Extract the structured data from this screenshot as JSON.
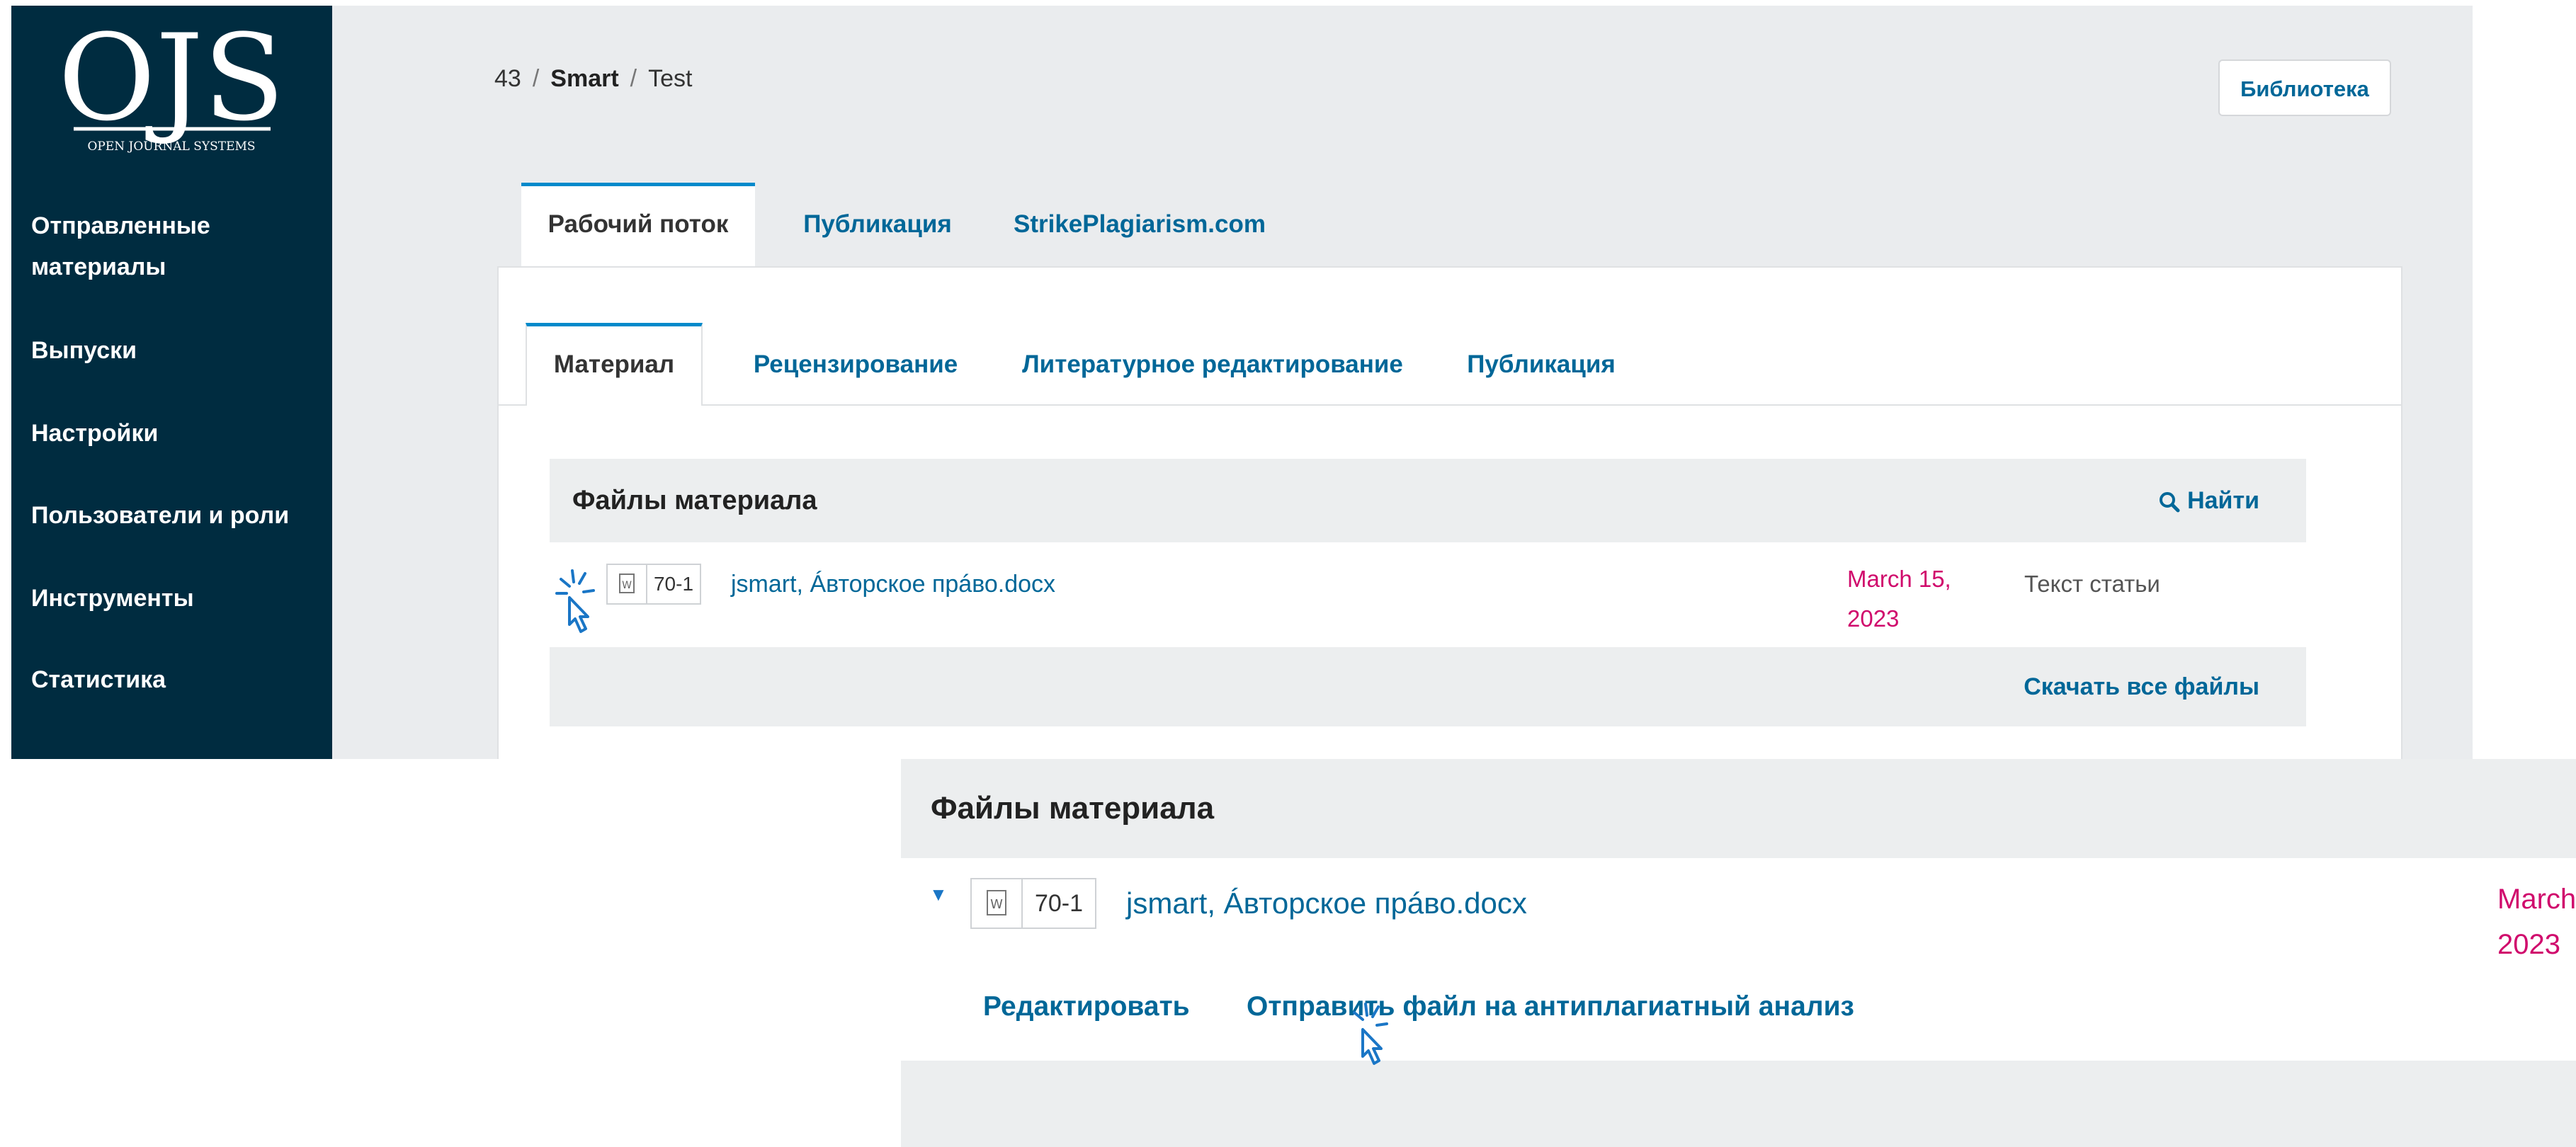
{
  "sidebar": {
    "logo": {
      "letters": "OJS",
      "caption": "OPEN JOURNAL SYSTEMS"
    },
    "items": [
      {
        "label": "Отправленные материалы"
      },
      {
        "label": "Выпуски"
      },
      {
        "label": "Настройки"
      },
      {
        "label": "Пользователи и роли"
      },
      {
        "label": "Инструменты"
      },
      {
        "label": "Статистика"
      }
    ]
  },
  "breadcrumb": {
    "id": "43",
    "journal": "Smart",
    "title": "Test"
  },
  "header": {
    "library_label": "Библиотека"
  },
  "main_tabs": [
    {
      "label": "Рабочий поток",
      "active": true
    },
    {
      "label": "Публикация",
      "active": false
    },
    {
      "label": "StrikePlagiarism.com",
      "active": false
    }
  ],
  "sub_tabs": [
    {
      "label": "Материал",
      "active": true
    },
    {
      "label": "Рецензирование",
      "active": false
    },
    {
      "label": "Литературное редактирование",
      "active": false
    },
    {
      "label": "Публикация",
      "active": false
    }
  ],
  "files_panel": {
    "title": "Файлы материала",
    "search_label": "Найти",
    "search_icon": "search-icon",
    "download_all_label": "Скачать все файлы",
    "files": [
      {
        "file_icon": "word-file-icon",
        "id": "70-1",
        "name": "jsmart, Áвторское прáво.docx",
        "date_line1": "March 15,",
        "date_line2": "2023",
        "type": "Текст статьи"
      }
    ]
  },
  "zoomed_panel": {
    "title": "Файлы материала",
    "expand_icon": "caret-down-icon",
    "file": {
      "file_icon": "word-file-icon",
      "id": "70-1",
      "name": "jsmart, Áвторское прáво.docx",
      "date_line1": "March",
      "date_line2": "2023"
    },
    "actions": {
      "edit_label": "Редактировать",
      "antiplagiarism_label": "Отправить файл на антиплагиатный анализ"
    }
  },
  "colors": {
    "sidebar_bg": "#002c40",
    "link": "#006798",
    "active_tab_border": "#008acb",
    "date": "#d00a6c",
    "page_bg": "#eaecee",
    "cursor": "#1a76c6"
  }
}
